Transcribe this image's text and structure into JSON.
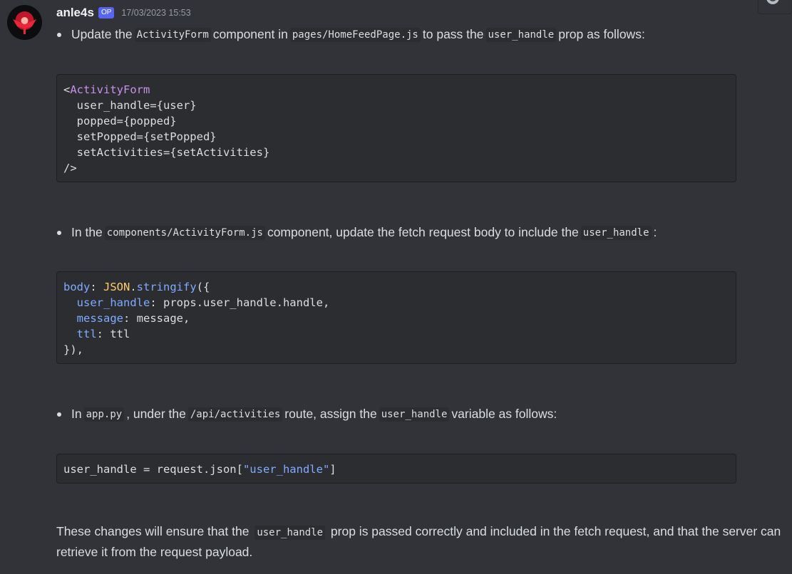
{
  "author": {
    "username": "anle4s",
    "badge": "OP",
    "timestamp": "17/03/2023 15:53",
    "avatar_icon": "red-bird-avatar"
  },
  "colors": {
    "background": "#313338",
    "code_background": "#2b2d31",
    "badge": "#5865f2"
  },
  "bullets": [
    {
      "t1": "Update the",
      "c1": "ActivityForm",
      "t2": "component in",
      "c2": "pages/HomeFeedPage.js",
      "t3": "to pass the",
      "c3": "user_handle",
      "t4": "prop as follows:"
    },
    {
      "t1": "In the",
      "c1": "components/ActivityForm.js",
      "t2": "component, update the fetch request body to include the",
      "c2": "user_handle",
      "t3": ":"
    },
    {
      "t1": "In",
      "c1": "app.py",
      "t2": ", under the",
      "c2": "/api/activities",
      "t3": "route, assign the",
      "c3": "user_handle",
      "t4": "variable as follows:"
    }
  ],
  "code1": {
    "open": "<",
    "component": "ActivityForm",
    "line2": "  user_handle={user}",
    "line3": "  popped={popped}",
    "line4": "  setPopped={setPopped}",
    "line5": "  setActivities={setActivities}",
    "line6": "/>"
  },
  "code2": {
    "body_key": "body",
    "colon": ": ",
    "json_obj": "JSON",
    "dot": ".",
    "method": "stringify",
    "paren": "({",
    "indent": "  ",
    "k1": "user_handle",
    "v1": ": props.user_handle.handle,",
    "k2": "message",
    "v2": ": message,",
    "k3": "ttl",
    "v3": ": ttl",
    "close": "}),"
  },
  "code3": {
    "lhs": "user_handle = request.json[",
    "str": "\"user_handle\"",
    "end": "]"
  },
  "closing": {
    "t1": "These changes will ensure that the",
    "c1": "user_handle",
    "t2": "prop is passed correctly and included in the fetch request, and that the server can retrieve it from the request payload."
  }
}
